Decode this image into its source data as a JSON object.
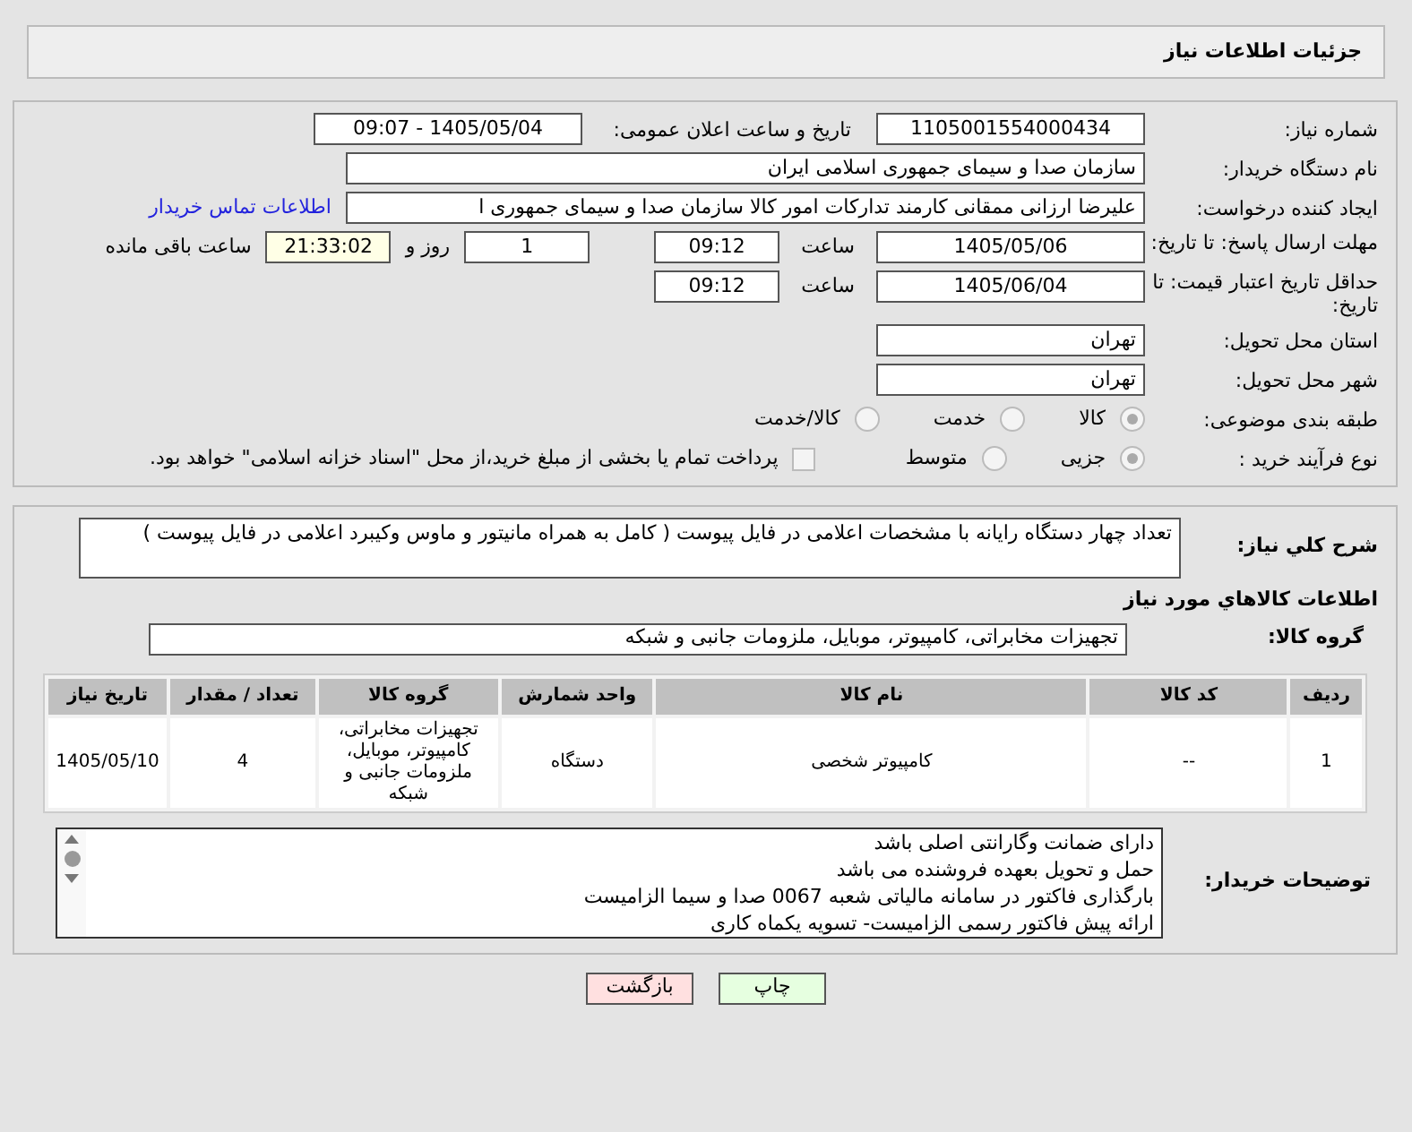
{
  "header": {
    "title": "جزئیات اطلاعات نیاز"
  },
  "need_number": {
    "label": "شماره نیاز:",
    "value": "1105001554000434"
  },
  "announce": {
    "label": "تاریخ و ساعت اعلان عمومی:",
    "value": "1405/05/04 - 09:07"
  },
  "buyer": {
    "label": "نام دستگاه خریدار:",
    "value": "سازمان صدا و سیمای جمهوری اسلامی ایران"
  },
  "creator": {
    "label": "ایجاد کننده درخواست:",
    "value": "علیرضا ارزانی ممقانی کارمند تدارکات امور کالا سازمان صدا و سیمای جمهوری ا",
    "link": "اطلاعات تماس خریدار"
  },
  "deadline": {
    "label": "مهلت ارسال پاسخ: تا تاریخ:",
    "date": "1405/05/06",
    "time_label": "ساعت",
    "time": "09:12",
    "days": "1",
    "days_label": "روز و",
    "remaining": "21:33:02",
    "remaining_label": "ساعت باقی مانده"
  },
  "validity": {
    "label": "حداقل تاریخ اعتبار قیمت: تا تاریخ:",
    "date": "1405/06/04",
    "time_label": "ساعت",
    "time": "09:12"
  },
  "province": {
    "label": "استان محل تحویل:",
    "value": "تهران"
  },
  "city": {
    "label": "شهر محل تحویل:",
    "value": "تهران"
  },
  "category": {
    "label": "طبقه بندی موضوعی:",
    "options": [
      {
        "label": "کالا",
        "selected": true
      },
      {
        "label": "خدمت",
        "selected": false
      },
      {
        "label": "کالا/خدمت",
        "selected": false
      }
    ]
  },
  "process": {
    "label": "نوع فرآیند خرید :",
    "options": [
      {
        "label": "جزیی",
        "selected": true
      },
      {
        "label": "متوسط",
        "selected": false
      }
    ],
    "payment": {
      "label": "پرداخت تمام یا بخشی از مبلغ خرید،از محل \"اسناد خزانه اسلامی\" خواهد بود.",
      "checked": false
    }
  },
  "description": {
    "label": "شرح کلي نياز:",
    "value": "تعداد چهار دستگاه رایانه با مشخصات اعلامی در فایل پیوست ( کامل به همراه مانیتور و ماوس  وکیبرد اعلامی در فایل پیوست )"
  },
  "goods_title": "اطلاعات کالاهاي مورد نياز",
  "goods_group": {
    "label": "گروه کالا:",
    "value": "تجهیزات مخابراتی، کامپیوتر، موبایل، ملزومات جانبی و شبکه"
  },
  "table": {
    "columns": [
      "ردیف",
      "کد کالا",
      "نام کالا",
      "واحد شمارش",
      "گروه کالا",
      "تعداد / مقدار",
      "تاریخ نیاز"
    ],
    "rows": [
      [
        "1",
        "--",
        "کامپیوتر شخصی",
        "دستگاه",
        "تجهیزات مخابراتی، کامپیوتر، موبایل، ملزومات جانبی و شبکه",
        "4",
        "1405/05/10"
      ]
    ]
  },
  "notes": {
    "label": "توضیحات خریدار:",
    "lines": [
      "دارای ضمانت وگارانتی اصلی باشد",
      "حمل و تحویل بعهده فروشنده می باشد",
      "بارگذاری فاکتور در سامانه مالیاتی شعبه 0067 صدا و سیما الزامیست",
      "ارائه پیش فاکتور رسمی الزامیست- تسویه یکماه کاری"
    ]
  },
  "buttons": [
    {
      "label": "چاپ",
      "kind": "print"
    },
    {
      "label": "بازگشت",
      "kind": "back"
    }
  ]
}
